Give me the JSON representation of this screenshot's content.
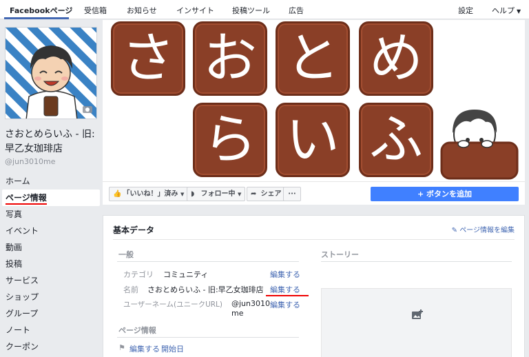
{
  "topbar": {
    "tabs": [
      "Facebookページ",
      "受信箱",
      "お知らせ",
      "インサイト",
      "投稿ツール",
      "広告"
    ],
    "settings": "設定",
    "help": "ヘルプ"
  },
  "page": {
    "name": "さおとめらいふ - 旧:早乙女珈琲店",
    "handle": "@jun3010me"
  },
  "nav": [
    "ホーム",
    "ページ情報",
    "写真",
    "イベント",
    "動画",
    "投稿",
    "サービス",
    "ショップ",
    "グループ",
    "ノート",
    "クーポン"
  ],
  "cover": {
    "row1": [
      "さ",
      "お",
      "と",
      "め"
    ],
    "row2": [
      "ら",
      "い",
      "ふ"
    ]
  },
  "actions": {
    "like": "「いいね！」済み",
    "follow": "フォロー中",
    "share": "シェア",
    "more": "···",
    "add_button": "+ ボタンを追加"
  },
  "info": {
    "title": "基本データ",
    "edit_page_info": "ページ情報を編集",
    "general_heading": "一般",
    "story_heading": "ストーリー",
    "rows": [
      {
        "label": "カテゴリ",
        "value": "コミュニティ",
        "edit": "編集する"
      },
      {
        "label": "名前",
        "value": "さおとめらいふ - 旧:早乙女珈琲店",
        "edit": "編集する"
      },
      {
        "label": "ユーザーネーム(ユニークURL)",
        "value_line1": "@jun3010",
        "value_line2": "me",
        "edit": "編集する"
      }
    ],
    "page_info_heading": "ページ情報",
    "edit_start": "編集する",
    "start_date": "開始日"
  },
  "colors": {
    "accent": "#4267b2",
    "add_button": "#4080ff",
    "tile": "#8a3f27",
    "highlight": "#e00000"
  }
}
